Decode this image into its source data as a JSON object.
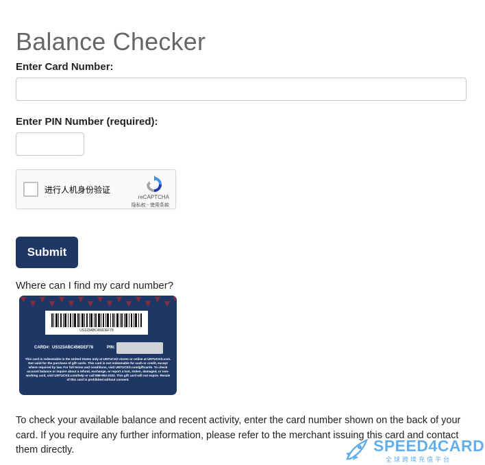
{
  "page": {
    "title": "Balance Checker"
  },
  "form": {
    "card_number_label": "Enter Card Number:",
    "card_number_value": "",
    "pin_label": "Enter PIN Number (required):",
    "pin_value": "",
    "submit_label": "Submit"
  },
  "captcha": {
    "checkbox_label": "进行人机身份验证",
    "brand": "reCAPTCHA",
    "links": "隐私权 - 使用条款",
    "checked": false
  },
  "help": {
    "find_card_text": "Where can I find my card number?"
  },
  "card_image": {
    "barcode_number": "US123ABC456DEF78",
    "card_label": "CARD#:",
    "card_value": "US123ABC456DEF78",
    "pin_label": "PIN:",
    "fine_print": "This card is redeemable in the United States only at UNTUCKit stores or online at UNTUCKit.com. Not valid for the purchase of gift cards. This card is not redeemable for cash or credit, except where required by law. For full terms and conditions, visit UNTUCKit.com/giftcards. To check account balance or inquire about a refund, exchange, or report a lost, stolen, damaged, or non-working card, visit UNTUCKit.com/help or call 888-952-3102. This gift card will not expire. Resale of this card is prohibited without consent.",
    "background_color": "#1f3764",
    "pattern_color": "#8c2a3c"
  },
  "description": "To check your available balance and recent activity, enter the card number shown on the back of your card. If you require any further information, please refer to the merchant issuing this card and contact them directly.",
  "watermark": {
    "brand": "SPEED4CARD",
    "tagline": "全球跨境充值平台",
    "icon": "rocket-icon"
  },
  "colors": {
    "submit_bg": "#1f3764",
    "title": "#666666",
    "watermark": "#4aa0e6"
  }
}
